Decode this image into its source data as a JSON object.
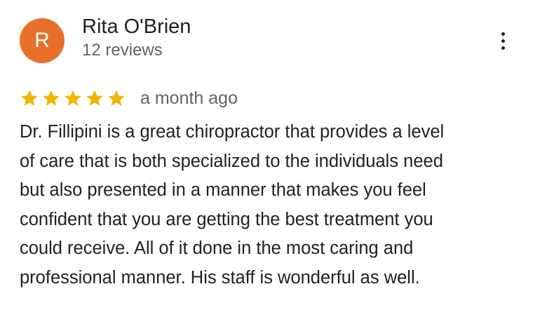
{
  "reviewer": {
    "avatar_letter": "R",
    "avatar_color": "#E8702A",
    "name": "Rita O'Brien",
    "reviews_count": "12 reviews"
  },
  "more_options_icon": "more-vertical-icon",
  "rating": {
    "stars": 5,
    "max_stars": 5,
    "star_color": "#F4B400",
    "icon": "star-icon"
  },
  "date": "a month ago",
  "review_text": "Dr. Fillipini is a great chiropractor that provides a level\nof care that is both specialized to the individuals need\nbut also presented in a manner that makes you feel\nconfident that you are getting the best treatment you\ncould receive.  All of it done in the most caring and\nprofessional manner.  His staff is wonderful as well."
}
